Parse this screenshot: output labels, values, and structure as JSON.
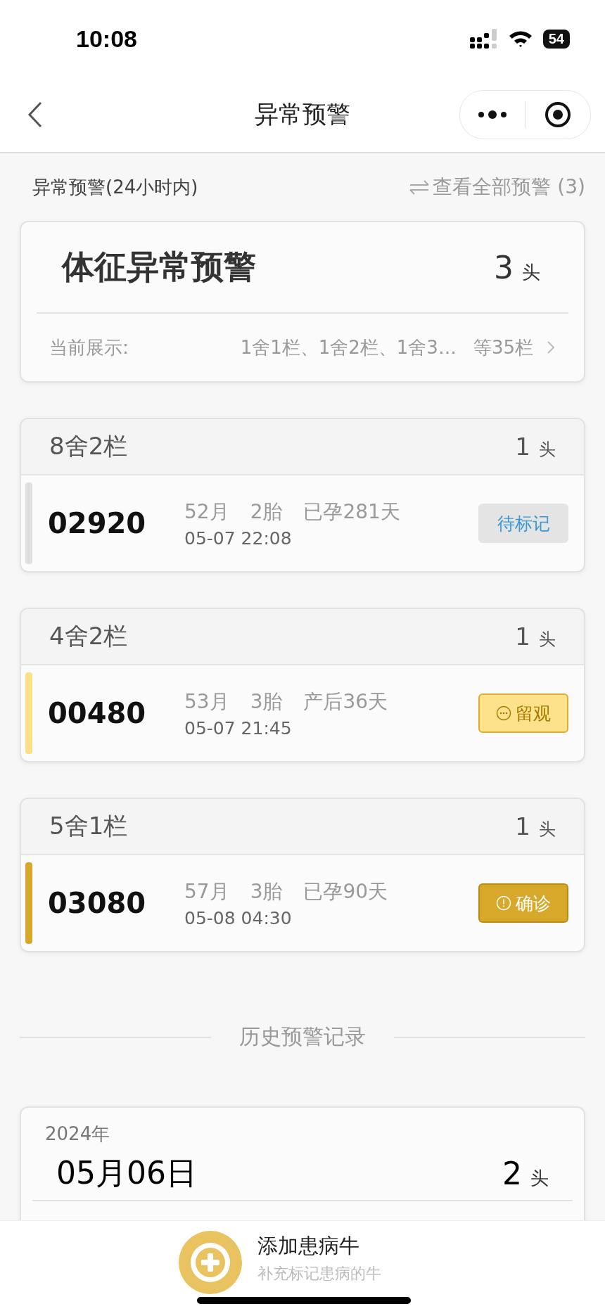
{
  "status_bar": {
    "time": "10:08",
    "battery": "54"
  },
  "nav": {
    "title": "异常预警"
  },
  "section": {
    "title": "异常预警(24小时内)",
    "link": "查看全部预警 (3)"
  },
  "summary": {
    "title": "体征异常预警",
    "count": "3",
    "unit": "头",
    "display_label": "当前展示:",
    "display_value": "1舍1栏、1舍2栏、1舍3…",
    "display_more": "等35栏"
  },
  "groups": [
    {
      "pen": "8舍2栏",
      "count": "1",
      "unit": "头",
      "rows": [
        {
          "id": "02920",
          "age": "52月",
          "parity": "2胎",
          "state": "已孕281天",
          "time": "05-07 22:08",
          "status": {
            "kind": "pending",
            "label": "待标记"
          }
        }
      ]
    },
    {
      "pen": "4舍2栏",
      "count": "1",
      "unit": "头",
      "rows": [
        {
          "id": "00480",
          "age": "53月",
          "parity": "3胎",
          "state": "产后36天",
          "time": "05-07 21:45",
          "status": {
            "kind": "observe",
            "label": "留观"
          }
        }
      ]
    },
    {
      "pen": "5舍1栏",
      "count": "1",
      "unit": "头",
      "rows": [
        {
          "id": "03080",
          "age": "57月",
          "parity": "3胎",
          "state": "已孕90天",
          "time": "05-08 04:30",
          "status": {
            "kind": "confirmed",
            "label": "确诊"
          }
        }
      ]
    }
  ],
  "history": {
    "title": "历史预警记录",
    "records": [
      {
        "year": "2024年",
        "date": "05月06日",
        "count": "2",
        "unit": "头"
      }
    ]
  },
  "bottom_action": {
    "title": "添加患病牛",
    "subtitle": "补充标记患病的牛"
  }
}
